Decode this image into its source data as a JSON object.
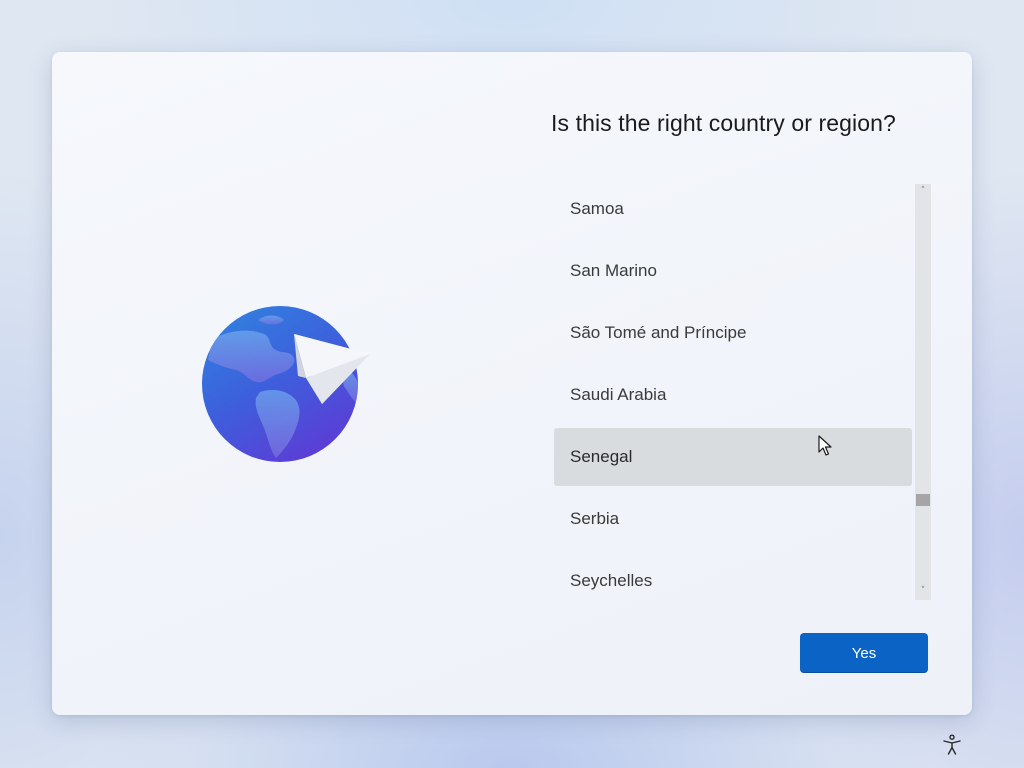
{
  "setup": {
    "title": "Is this the right country or region?",
    "countries": [
      {
        "label": "Samoa",
        "selected": false
      },
      {
        "label": "San Marino",
        "selected": false
      },
      {
        "label": "São Tomé and Príncipe",
        "selected": false
      },
      {
        "label": "Saudi Arabia",
        "selected": false
      },
      {
        "label": "Senegal",
        "selected": true
      },
      {
        "label": "Serbia",
        "selected": false
      },
      {
        "label": "Seychelles",
        "selected": false
      }
    ],
    "yes_label": "Yes"
  },
  "scrollbar": {
    "up_arrow": "˄",
    "down_arrow": "˅",
    "position_fraction": 0.76
  },
  "icons": {
    "illustration": "globe-paper-plane-icon",
    "accessibility": "accessibility-icon",
    "cursor": "mouse-pointer-icon"
  },
  "colors": {
    "accent": "#0c63c6",
    "selected_row": "#d9dcdf",
    "globe_dark": "#4a40d6",
    "globe_light": "#2f86e0"
  }
}
